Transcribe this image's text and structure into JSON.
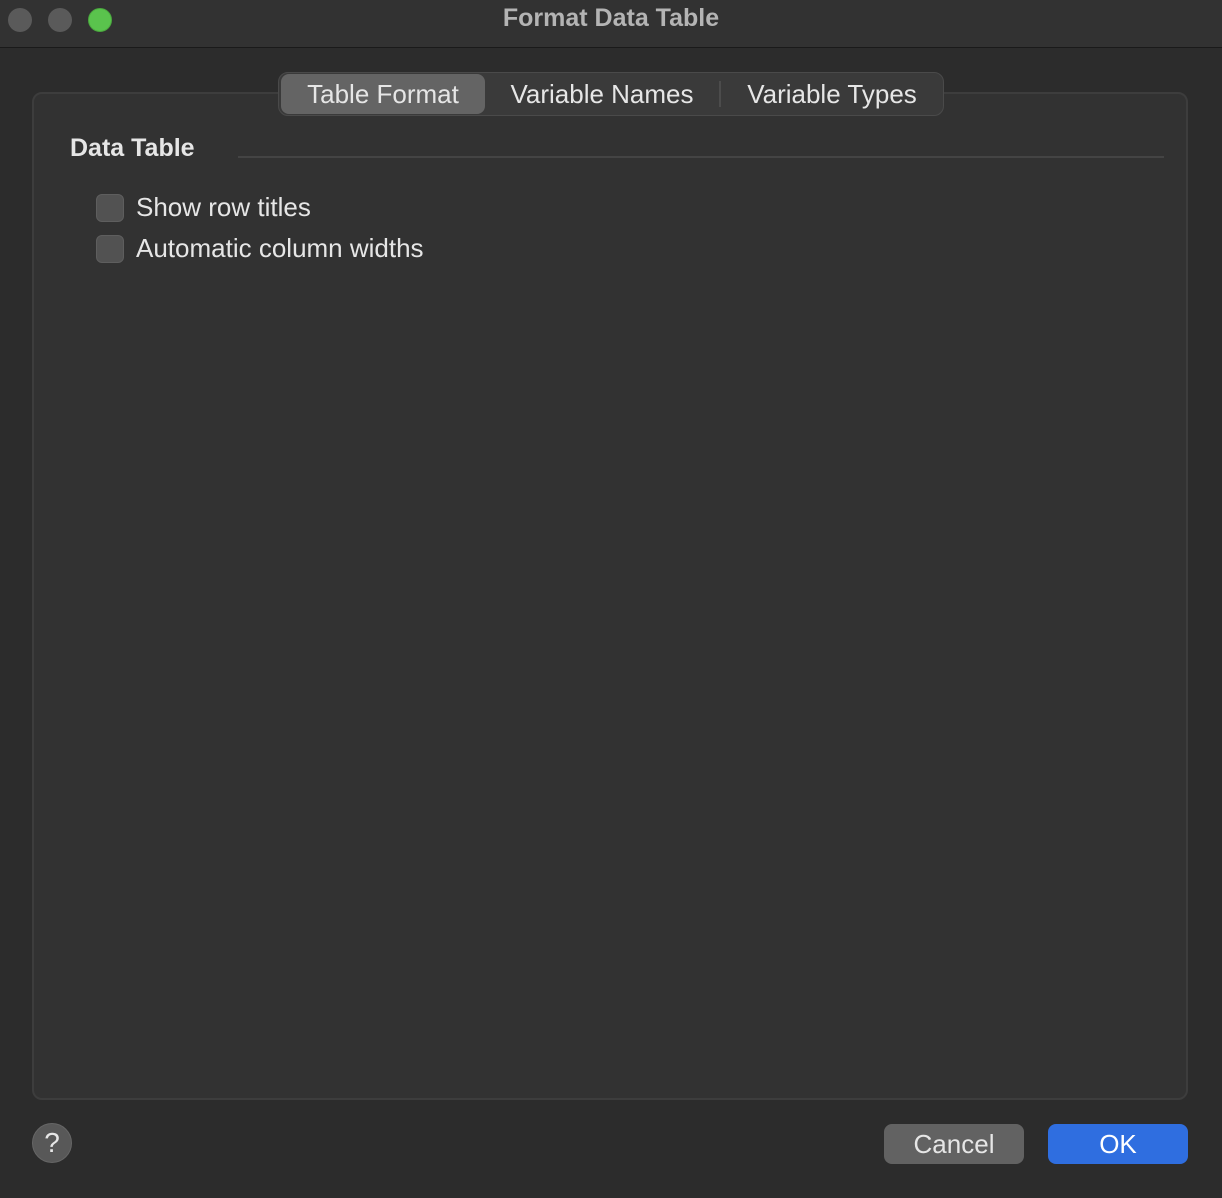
{
  "window": {
    "title": "Format Data Table"
  },
  "tabs": [
    {
      "label": "Table Format",
      "selected": true
    },
    {
      "label": "Variable Names",
      "selected": false
    },
    {
      "label": "Variable Types",
      "selected": false
    }
  ],
  "section": {
    "title": "Data Table",
    "options": [
      {
        "label": "Show row titles",
        "checked": false
      },
      {
        "label": "Automatic column widths",
        "checked": false
      }
    ]
  },
  "footer": {
    "help_label": "?",
    "cancel_label": "Cancel",
    "ok_label": "OK"
  },
  "colors": {
    "accent": "#2f6ee0",
    "zoom_button": "#5ac34d"
  }
}
